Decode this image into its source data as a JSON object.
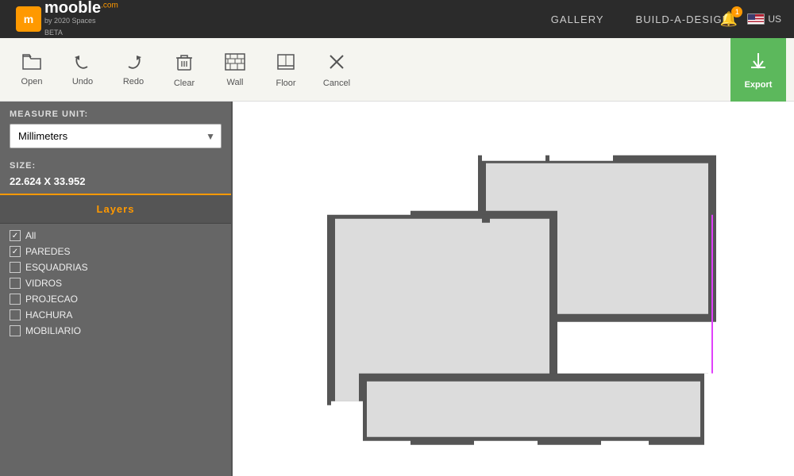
{
  "nav": {
    "logo": "mooble",
    "logo_com": ".com",
    "logo_by": "by 2020 Spaces",
    "logo_beta": "BETA",
    "links": [
      "GALLERY",
      "BUILD-A-DESIGN"
    ],
    "notification_count": "1",
    "flag_label": "US"
  },
  "toolbar": {
    "buttons": [
      {
        "id": "open",
        "label": "Open",
        "icon": "📂"
      },
      {
        "id": "undo",
        "label": "Undo",
        "icon": "↩"
      },
      {
        "id": "redo",
        "label": "Redo",
        "icon": "↪"
      },
      {
        "id": "clear",
        "label": "Clear",
        "icon": "🗑"
      },
      {
        "id": "wall",
        "label": "Wall",
        "icon": "▦"
      },
      {
        "id": "floor",
        "label": "Floor",
        "icon": "⬜"
      },
      {
        "id": "cancel",
        "label": "Cancel",
        "icon": "✕"
      }
    ],
    "export_label": "Export"
  },
  "sidebar": {
    "measure_label": "MEASURE UNIT:",
    "unit": "Millimeters",
    "size_label": "SIZE:",
    "size_value": "22.624 X 33.952",
    "layers_label": "Layers",
    "layers": [
      {
        "id": "all",
        "name": "All",
        "checked": true
      },
      {
        "id": "paredes",
        "name": "PAREDES",
        "checked": true
      },
      {
        "id": "esquadrias",
        "name": "ESQUADRIAS",
        "checked": false
      },
      {
        "id": "vidros",
        "name": "VIDROS",
        "checked": false
      },
      {
        "id": "projecao",
        "name": "PROJECAO",
        "checked": false
      },
      {
        "id": "hachura",
        "name": "HACHURA",
        "checked": false
      },
      {
        "id": "mobiliario",
        "name": "MOBILIARIO",
        "checked": false
      }
    ]
  },
  "canvas": {
    "bg": "#ffffff"
  }
}
